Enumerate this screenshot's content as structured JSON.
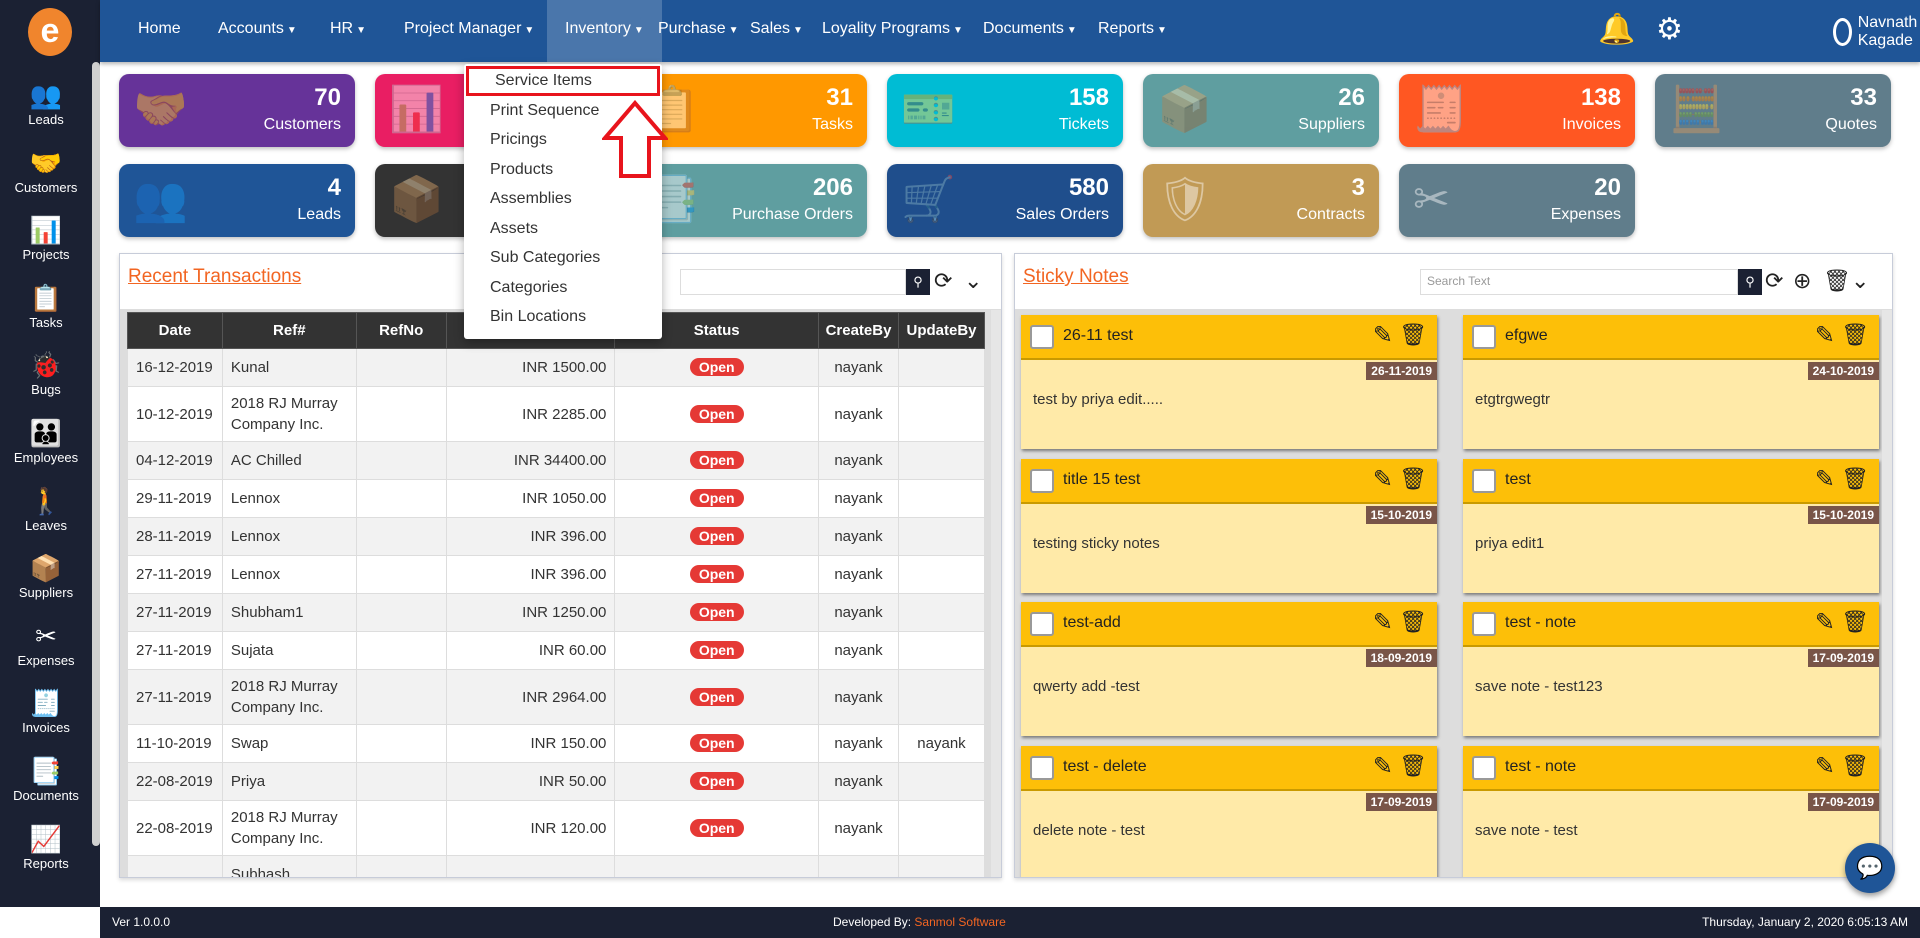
{
  "sidebar": {
    "items": [
      {
        "label": "Leads",
        "icon": "leads-icon",
        "glyph": "👥"
      },
      {
        "label": "Customers",
        "icon": "handshake-icon",
        "glyph": "🤝"
      },
      {
        "label": "Projects",
        "icon": "projects-icon",
        "glyph": "📊"
      },
      {
        "label": "Tasks",
        "icon": "clipboard-icon",
        "glyph": "📋"
      },
      {
        "label": "Bugs",
        "icon": "bug-icon",
        "glyph": "🐞"
      },
      {
        "label": "Employees",
        "icon": "employees-icon",
        "glyph": "👪"
      },
      {
        "label": "Leaves",
        "icon": "traveler-icon",
        "glyph": "🚶"
      },
      {
        "label": "Suppliers",
        "icon": "supplier-icon",
        "glyph": "📦"
      },
      {
        "label": "Expenses",
        "icon": "scissors-coupon-icon",
        "glyph": "✂"
      },
      {
        "label": "Invoices",
        "icon": "invoice-icon",
        "glyph": "🧾"
      },
      {
        "label": "Documents",
        "icon": "documents-icon",
        "glyph": "📑"
      },
      {
        "label": "Reports",
        "icon": "reports-icon",
        "glyph": "📈"
      }
    ]
  },
  "nav": {
    "items": [
      {
        "label": "Home",
        "caret": false
      },
      {
        "label": "Accounts",
        "caret": true
      },
      {
        "label": "HR",
        "caret": true
      },
      {
        "label": "Project Manager",
        "caret": true
      },
      {
        "label": "Inventory",
        "caret": true,
        "active": true
      },
      {
        "label": "Purchase",
        "caret": true
      },
      {
        "label": "Sales",
        "caret": true
      },
      {
        "label": "Loyality Programs",
        "caret": true
      },
      {
        "label": "Documents",
        "caret": true
      },
      {
        "label": "Reports",
        "caret": true
      }
    ],
    "user": "Navnath Kagade"
  },
  "inventory_menu": {
    "items": [
      "Service Items",
      "Print Sequence",
      "Pricings",
      "Products",
      "Assemblies",
      "Assets",
      "Sub Categories",
      "Categories",
      "Bin Locations"
    ],
    "highlighted": "Service Items"
  },
  "tiles": [
    [
      {
        "value": "70",
        "label": "Customers",
        "color": "#663399",
        "glyph": "🤝"
      },
      {
        "value": "",
        "label": "",
        "color": "#e91e63",
        "glyph": "📊"
      },
      {
        "value": "31",
        "label": "Tasks",
        "color": "#ff9800",
        "glyph": "📋"
      },
      {
        "value": "158",
        "label": "Tickets",
        "color": "#00bcd4",
        "glyph": "🎫"
      },
      {
        "value": "26",
        "label": "Suppliers",
        "color": "#5f9ea0",
        "glyph": "📦"
      },
      {
        "value": "138",
        "label": "Invoices",
        "color": "#ff5722",
        "glyph": "🧾"
      },
      {
        "value": "33",
        "label": "Quotes",
        "color": "#607d8b",
        "glyph": "🧮"
      }
    ],
    [
      {
        "value": "4",
        "label": "Leads",
        "color": "#1f5597",
        "glyph": "👥"
      },
      {
        "value": "",
        "label": "",
        "color": "#333333",
        "glyph": "📦"
      },
      {
        "value": "206",
        "label": "Purchase Orders",
        "color": "#5f9ea0",
        "glyph": "📑"
      },
      {
        "value": "580",
        "label": "Sales Orders",
        "color": "#1f4e8c",
        "glyph": "🛒"
      },
      {
        "value": "3",
        "label": "Contracts",
        "color": "#c19a55",
        "glyph": "🛡"
      },
      {
        "value": "20",
        "label": "Expenses",
        "color": "#607d8b",
        "glyph": "✂"
      }
    ]
  ],
  "transactions": {
    "title": "Recent Transactions",
    "columns": [
      "Date",
      "Ref#",
      "RefNo",
      "",
      "Status",
      "CreateBy",
      "UpdateBy"
    ],
    "rows": [
      [
        "16-12-2019",
        "Kunal",
        "",
        "INR 1500.00",
        "Open",
        "nayank",
        ""
      ],
      [
        "10-12-2019",
        "2018 RJ Murray Company Inc.",
        "",
        "INR 2285.00",
        "Open",
        "nayank",
        ""
      ],
      [
        "04-12-2019",
        "AC Chilled",
        "",
        "INR 34400.00",
        "Open",
        "nayank",
        ""
      ],
      [
        "29-11-2019",
        "Lennox",
        "",
        "INR 1050.00",
        "Open",
        "nayank",
        ""
      ],
      [
        "28-11-2019",
        "Lennox",
        "",
        "INR 396.00",
        "Open",
        "nayank",
        ""
      ],
      [
        "27-11-2019",
        "Lennox",
        "",
        "INR 396.00",
        "Open",
        "nayank",
        ""
      ],
      [
        "27-11-2019",
        "Shubham1",
        "",
        "INR 1250.00",
        "Open",
        "nayank",
        ""
      ],
      [
        "27-11-2019",
        "Sujata",
        "",
        "INR 60.00",
        "Open",
        "nayank",
        ""
      ],
      [
        "27-11-2019",
        "2018 RJ Murray Company Inc.",
        "",
        "INR 2964.00",
        "Open",
        "nayank",
        ""
      ],
      [
        "11-10-2019",
        "Swap",
        "",
        "INR 150.00",
        "Open",
        "nayank",
        "nayank"
      ],
      [
        "22-08-2019",
        "Priya",
        "",
        "INR 50.00",
        "Open",
        "nayank",
        ""
      ],
      [
        "22-08-2019",
        "2018 RJ Murray Company Inc.",
        "",
        "INR 120.00",
        "Open",
        "nayank",
        ""
      ],
      [
        "",
        "Subhash",
        "",
        "",
        "",
        "",
        ""
      ]
    ]
  },
  "sticky": {
    "title": "Sticky Notes",
    "search_placeholder": "Search Text",
    "notes": [
      {
        "title": "26-11 test",
        "date": "26-11-2019",
        "body": "test by priya edit....."
      },
      {
        "title": "efgwe",
        "date": "24-10-2019",
        "body": "etgtrgwegtr"
      },
      {
        "title": "title 15 test",
        "date": "15-10-2019",
        "body": "testing sticky notes"
      },
      {
        "title": "test",
        "date": "15-10-2019",
        "body": "priya edit1"
      },
      {
        "title": "test-add",
        "date": "18-09-2019",
        "body": "qwerty add -test"
      },
      {
        "title": "test - note",
        "date": "17-09-2019",
        "body": "save note - test123"
      },
      {
        "title": "test - delete",
        "date": "17-09-2019",
        "body": "delete note - test"
      },
      {
        "title": "test - note",
        "date": "17-09-2019",
        "body": "save note - test"
      }
    ]
  },
  "footer": {
    "version": "Ver 1.0.0.0",
    "developed_by": "Developed By: ",
    "company": "Sanmol Software",
    "datetime": "Thursday, January 2, 2020 6:05:13 AM"
  },
  "colors": {
    "nav": "#1f5597",
    "sidebar": "#1b2133",
    "accent": "#f26522",
    "note_header": "#fdbf08",
    "status_open": "#e53935"
  }
}
